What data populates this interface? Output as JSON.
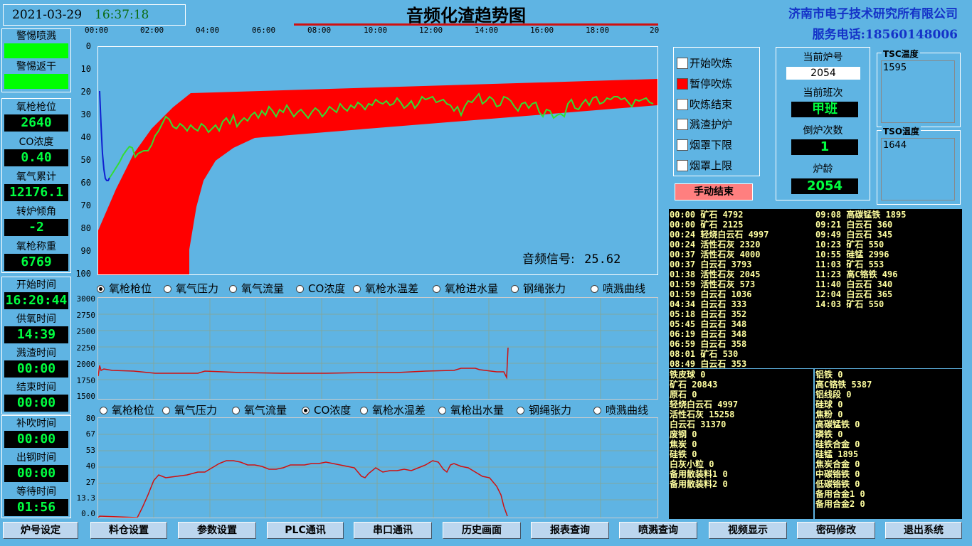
{
  "header": {
    "date": "2021-03-29",
    "time": "16:37:18",
    "title": "音频化渣趋势图",
    "company": "济南市电子技术研究所有限公司",
    "phone": "服务电话:18560148006"
  },
  "alarms": [
    {
      "label": "警惕喷溅"
    },
    {
      "label": "警惕返干"
    }
  ],
  "left_params": [
    {
      "label": "氧枪枪位",
      "value": "2640"
    },
    {
      "label": "CO浓度",
      "value": "0.40"
    },
    {
      "label": "氧气累计",
      "value": "12176.1"
    },
    {
      "label": "转炉倾角",
      "value": "-2"
    },
    {
      "label": "氧枪称重",
      "value": "6769"
    }
  ],
  "left_times": [
    {
      "label": "开始时间",
      "value": "16:20:44"
    },
    {
      "label": "供氧时间",
      "value": "14:39"
    },
    {
      "label": "溅渣时间",
      "value": "00:00"
    },
    {
      "label": "结束时间",
      "value": "00:00"
    },
    {
      "label": "补吹时间",
      "value": "00:00"
    },
    {
      "label": "出钢时间",
      "value": "00:00"
    },
    {
      "label": "等待时间",
      "value": "01:56"
    }
  ],
  "main_chart": {
    "x_ticks": [
      "00:00",
      "02:00",
      "04:00",
      "06:00",
      "08:00",
      "10:00",
      "12:00",
      "14:00",
      "16:00",
      "18:00",
      "20"
    ],
    "y_ticks": [
      "0",
      "10",
      "20",
      "30",
      "40",
      "50",
      "60",
      "70",
      "80",
      "90",
      "100"
    ],
    "signal_label": "音频信号:",
    "signal_value": "25.62",
    "colors": {
      "band": "#ff0000",
      "trend": "#33dd33",
      "trend_start": "#1020d0"
    }
  },
  "radio_row_1": {
    "items": [
      {
        "label": "氧枪枪位",
        "checked": true
      },
      {
        "label": "氧气压力",
        "checked": false
      },
      {
        "label": "氧气流量",
        "checked": false
      },
      {
        "label": "CO浓度",
        "checked": false
      },
      {
        "label": "氧枪水温差",
        "checked": false
      },
      {
        "label": "氧枪进水量",
        "checked": false
      },
      {
        "label": "钢绳张力",
        "checked": false
      },
      {
        "label": "喷溅曲线",
        "checked": false
      }
    ]
  },
  "radio_row_2": {
    "items": [
      {
        "label": "氧枪枪位",
        "checked": false
      },
      {
        "label": "氧气压力",
        "checked": false
      },
      {
        "label": "氧气流量",
        "checked": false
      },
      {
        "label": "CO浓度",
        "checked": true
      },
      {
        "label": "氧枪水温差",
        "checked": false
      },
      {
        "label": "氧枪出水量",
        "checked": false
      },
      {
        "label": "钢绳张力",
        "checked": false
      },
      {
        "label": "喷溅曲线",
        "checked": false
      }
    ]
  },
  "chart1": {
    "y_ticks": [
      "3000",
      "2750",
      "2500",
      "2250",
      "2000",
      "1750",
      "1500"
    ]
  },
  "chart2": {
    "y_ticks": [
      "80",
      "67",
      "53",
      "40",
      "27",
      "13.3",
      "0.0"
    ]
  },
  "controls": {
    "checkboxes": [
      {
        "label": "开始吹炼",
        "checked": false
      },
      {
        "label": "暂停吹炼",
        "checked": true
      },
      {
        "label": "吹炼结束",
        "checked": false
      },
      {
        "label": "溅渣护炉",
        "checked": false
      },
      {
        "label": "烟罩下限",
        "checked": false
      },
      {
        "label": "烟罩上限",
        "checked": false
      }
    ],
    "manual_end": "手动结束"
  },
  "furnace": {
    "no_label": "当前炉号",
    "no_value": "2054",
    "shift_label": "当前班次",
    "shift_value": "甲班",
    "count_label": "倒炉次数",
    "count_value": "1",
    "age_label": "炉龄",
    "age_value": "2054"
  },
  "temps": {
    "tsc_label": "TSC温度",
    "tsc_value": "1595",
    "tso_label": "TSO温度",
    "tso_value": "1644"
  },
  "log_left": [
    "00:00 矿石 4792",
    "00:00 矿石 2125",
    "00:24 轻烧白云石 4997",
    "00:24 活性石灰 2320",
    "00:37 活性石灰 4000",
    "00:37 白云石 3793",
    "01:38 活性石灰 2045",
    "01:59 活性石灰 573",
    "01:59 白云石 1036",
    "04:34 白云石 333",
    "05:18 白云石 352",
    "05:45 白云石 348",
    "06:19 白云石 348",
    "06:59 白云石 358",
    "08:01 矿石 530",
    "08:49 白云石 353"
  ],
  "log_right": [
    "09:08 高碳锰铁 1895",
    "09:21 白云石 360",
    "09:49 白云石 345",
    "10:23 矿石 550",
    "10:55 硅锰 2996",
    "11:03 矿石 553",
    "11:23 高C铬铁 496",
    "11:40 白云石 340",
    "12:04 白云石 365",
    "14:03 矿石 550"
  ],
  "totals_left": [
    "铁皮球 0",
    "矿石 20843",
    "原石 0",
    "轻烧白云石 4997",
    "活性石灰 15258",
    "白云石 31370",
    "废钢 0",
    "焦炭 0",
    "硅铁 0",
    "白灰小粒 0",
    "备用散装料1 0",
    "备用散装料2 0"
  ],
  "totals_right": [
    "铝铁 0",
    "高C铬铁 5387",
    "铝线段 0",
    "硅球 0",
    "焦粉 0",
    "高碳锰铁 0",
    "磷铁 0",
    "硅铁合金 0",
    "硅锰 1895",
    "焦炭合金 0",
    "中碳铬铁 0",
    "低碳铬铁 0",
    "备用合金1 0",
    "备用合金2 0"
  ],
  "bottom_buttons": [
    "炉号设定",
    "料仓设置",
    "参数设置",
    "PLC通讯",
    "串口通讯",
    "历史画面",
    "报表查询",
    "喷溅查询",
    "视频显示",
    "密码修改",
    "退出系统"
  ]
}
